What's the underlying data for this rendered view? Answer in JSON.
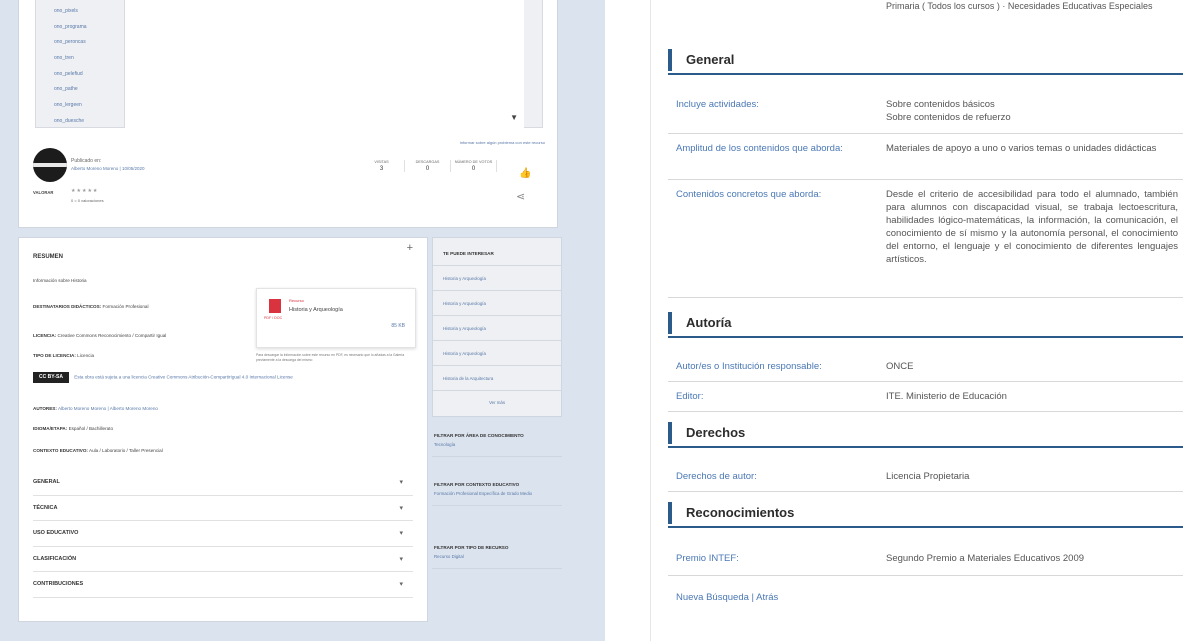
{
  "left": {
    "files": [
      "ono_pixels",
      "ono_programa",
      "ono_peroncas",
      "ono_tren",
      "ono_pelefiud",
      "ono_pathe",
      "ono_lergeen",
      "ono_duesche"
    ],
    "top_link": "Informar sobre algún problema con este recurso",
    "published_label": "Publicado en:",
    "published_author": "Alberto Moreno Moreno | 10/05/2020",
    "stats": [
      {
        "label": "VISITAS",
        "value": "3"
      },
      {
        "label": "DESCARGAS",
        "value": "0"
      },
      {
        "label": "NÚMERO DE VOTOS",
        "value": "0"
      }
    ],
    "rating_label": "VALORAR",
    "stars": "★★★★★",
    "votes_text": "0 = 0 valoraciones",
    "summary_title": "RESUMEN",
    "meta": {
      "info": "Información sobre Historia",
      "destinatarios_label": "DESTINATARIOS DIDÁCTICOS:",
      "destinatarios": "Formación Profesional",
      "licencia_label": "LICENCIA:",
      "licencia": "Creative Commons Reconocimiento / Compartir Igual",
      "tipo_label": "TIPO DE LICENCIA:",
      "tipo": "Licencia",
      "cc_badge": "CC BY-SA",
      "cc_text": "Esta obra está sujeta a una licencia Creative Commons Atribución-CompartirIgual 4.0 Internacional License",
      "autores_label": "AUTORES:",
      "autores": "Alberto Moreno Moreno | Alberto Moreno Moreno",
      "idioma_label": "IDIOMA/ETAPA:",
      "idioma": "Español / Bachillerato",
      "contexto_label": "CONTEXTO EDUCATIVO:",
      "contexto": "Aula / Laboratorio / Taller Presencial"
    },
    "resource": {
      "tag": "Recurso",
      "icon_label": "PDF / DOC",
      "name": "Historia y Arqueología",
      "size": "85 KB",
      "note": "Para descargar la información sobre este recurso en PDF, es necesario que lo añadas a la Galería previamente a la descarga del mismo"
    },
    "accordion": [
      "GENERAL",
      "TÉCNICA",
      "USO EDUCATIVO",
      "CLASIFICACIÓN",
      "CONTRIBUCIONES"
    ],
    "interest_title": "TE PUEDE INTERESAR",
    "interest_items": [
      "Historia y Arqueología",
      "Historia y Arqueología",
      "Historia y Arqueología",
      "Historia y Arqueología",
      "Historia de la Arquitectura"
    ],
    "see_more": "Ver más",
    "filters": [
      {
        "title": "FILTRAR POR ÁREA DE CONOCIMIENTO",
        "link": "Tecnología"
      },
      {
        "title": "FILTRAR POR CONTEXTO EDUCATIVO",
        "link": "Formación Profesional Específica de Grado Medio"
      },
      {
        "title": "FILTRAR POR TIPO DE RECURSO",
        "link": "Recurso Digital"
      }
    ]
  },
  "right": {
    "top_cut": "Primaria ( Todos los cursos ) · Necesidades Educativas Especiales",
    "sections": [
      {
        "title": "General",
        "rows": [
          {
            "k": "Incluye actividades:",
            "v": "Sobre contenidos básicos\nSobre contenidos de refuerzo"
          },
          {
            "k": "Amplitud de los contenidos que aborda:",
            "v": "Materiales de apoyo a uno o varios temas o unidades didácticas"
          },
          {
            "k": "Contenidos concretos que aborda:",
            "v": "Desde el criterio de accesibilidad para todo el alumnado, también para alumnos con discapacidad visual, se trabaja lectoescritura, habilidades lógico-matemáticas, la información, la comunicación, el conocimiento de sí mismo y la autonomía personal, el conocimiento del entorno, el lenguaje y el conocimiento de diferentes lenguajes artísticos."
          }
        ]
      },
      {
        "title": "Autoría",
        "rows": [
          {
            "k": "Autor/es o Institución responsable:",
            "v": "ONCE"
          },
          {
            "k": "Editor:",
            "v": "ITE. Ministerio de Educación"
          }
        ]
      },
      {
        "title": "Derechos",
        "rows": [
          {
            "k": "Derechos de autor:",
            "v": "Licencia Propietaria"
          }
        ]
      },
      {
        "title": "Reconocimientos",
        "rows": [
          {
            "k": "Premio INTEF:",
            "v": "Segundo Premio a Materiales Educativos 2009"
          }
        ]
      }
    ],
    "footer": "Nueva Búsqueda | Atrás"
  }
}
